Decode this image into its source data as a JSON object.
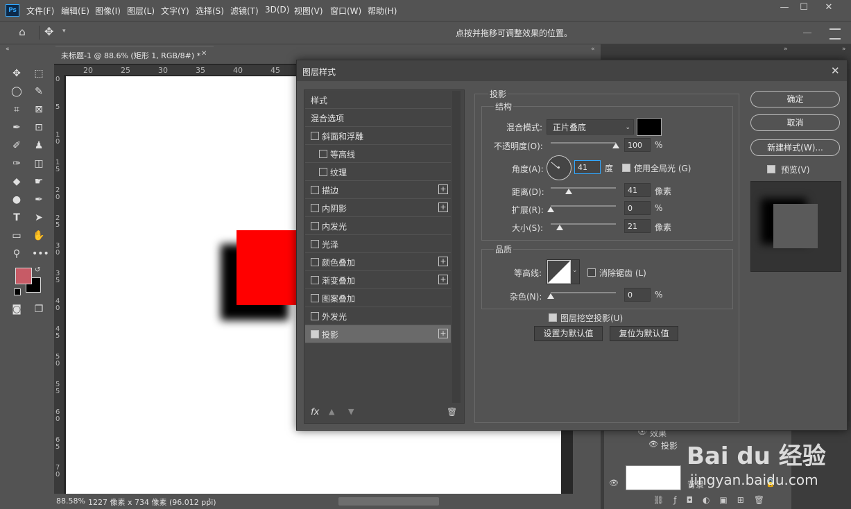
{
  "app": {
    "logo": "Ps"
  },
  "menu": [
    "文件(F)",
    "编辑(E)",
    "图像(I)",
    "图层(L)",
    "文字(Y)",
    "选择(S)",
    "滤镜(T)",
    "3D(D)",
    "视图(V)",
    "窗口(W)",
    "帮助(H)"
  ],
  "options": {
    "hint": "点按并拖移可调整效果的位置。"
  },
  "document": {
    "tab_title": "未标题-1 @ 88.6% (矩形 1, RGB/8#) *",
    "ruler_ticks": [
      "20",
      "25",
      "30",
      "35",
      "40",
      "45"
    ],
    "v_ruler": [
      "0",
      "5",
      "1\n0",
      "1\n5",
      "2\n0",
      "2\n5",
      "3\n0",
      "3\n5",
      "4\n0",
      "4\n5",
      "5\n0",
      "5\n5",
      "6\n0",
      "6\n5",
      "7\n0"
    ],
    "shape_color": "#ff0000",
    "zoom": "88.58%",
    "status": "1227 像素 x 734 像素 (96.012 ppi)"
  },
  "colors": {
    "foreground": "#c75b66",
    "background": "#000000"
  },
  "dialog": {
    "title": "图层样式",
    "list": [
      {
        "label": "样式",
        "checkbox": false,
        "plus": false,
        "indent": false,
        "checked": false,
        "selected": false
      },
      {
        "label": "混合选项",
        "checkbox": false,
        "plus": false,
        "indent": false,
        "checked": false,
        "selected": false
      },
      {
        "label": "斜面和浮雕",
        "checkbox": true,
        "plus": false,
        "indent": false,
        "checked": false,
        "selected": false
      },
      {
        "label": "等高线",
        "checkbox": true,
        "plus": false,
        "indent": true,
        "checked": false,
        "selected": false
      },
      {
        "label": "纹理",
        "checkbox": true,
        "plus": false,
        "indent": true,
        "checked": false,
        "selected": false
      },
      {
        "label": "描边",
        "checkbox": true,
        "plus": true,
        "indent": false,
        "checked": false,
        "selected": false
      },
      {
        "label": "内阴影",
        "checkbox": true,
        "plus": true,
        "indent": false,
        "checked": false,
        "selected": false
      },
      {
        "label": "内发光",
        "checkbox": true,
        "plus": false,
        "indent": false,
        "checked": false,
        "selected": false
      },
      {
        "label": "光泽",
        "checkbox": true,
        "plus": false,
        "indent": false,
        "checked": false,
        "selected": false
      },
      {
        "label": "颜色叠加",
        "checkbox": true,
        "plus": true,
        "indent": false,
        "checked": false,
        "selected": false
      },
      {
        "label": "渐变叠加",
        "checkbox": true,
        "plus": true,
        "indent": false,
        "checked": false,
        "selected": false
      },
      {
        "label": "图案叠加",
        "checkbox": true,
        "plus": false,
        "indent": false,
        "checked": false,
        "selected": false
      },
      {
        "label": "外发光",
        "checkbox": true,
        "plus": false,
        "indent": false,
        "checked": false,
        "selected": false
      },
      {
        "label": "投影",
        "checkbox": true,
        "plus": true,
        "indent": false,
        "checked": true,
        "selected": true
      }
    ],
    "section_title": "投影",
    "structure": {
      "title": "结构",
      "blend_label": "混合模式:",
      "blend_value": "正片叠底",
      "shadow_color": "#000000",
      "opacity_label": "不透明度(O):",
      "opacity_value": "100",
      "opacity_pct": 100,
      "pct": "%",
      "angle_label": "角度(A):",
      "angle_value": "41",
      "angle_unit": "度",
      "global_light_label": "使用全局光 (G)",
      "distance_label": "距离(D):",
      "distance_value": "41",
      "distance_pct": 28,
      "px_unit": "像素",
      "spread_label": "扩展(R):",
      "spread_value": "0",
      "spread_pct": 0,
      "size_label": "大小(S):",
      "size_value": "21",
      "size_pct": 14
    },
    "quality": {
      "title": "品质",
      "contour_label": "等高线:",
      "anti_alias_label": "消除锯齿 (L)",
      "noise_label": "杂色(N):",
      "noise_value": "0",
      "noise_pct": 0,
      "pct": "%"
    },
    "knockout_label": "图层挖空投影(U)",
    "set_default": "设置为默认值",
    "reset_default": "复位为默认值",
    "ok": "确定",
    "cancel": "取消",
    "new_style": "新建样式(W)...",
    "preview_label": "预览(V)",
    "fx": "fx"
  },
  "layers": {
    "effects_label": "效果",
    "shadow_label": "投影",
    "background_label": "背景"
  },
  "watermark": {
    "text": "Bai du 经验",
    "url": "jingyan.baidu.com"
  }
}
